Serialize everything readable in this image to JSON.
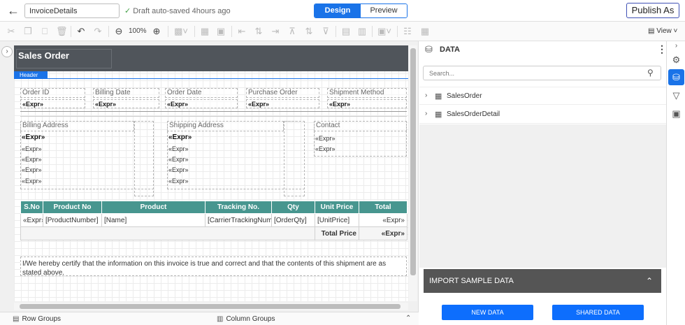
{
  "topbar": {
    "report_name": "InvoiceDetails",
    "autosave": "Draft auto-saved 4hours ago",
    "design_label": "Design",
    "preview_label": "Preview",
    "publish_label": "Publish As"
  },
  "toolbar": {
    "zoom": "100%",
    "view_label": "View"
  },
  "report": {
    "title": "Sales Order",
    "section_tab": "Header",
    "fields_row1": [
      {
        "label": "Order ID",
        "value": "«Expr»"
      },
      {
        "label": "Billing Date",
        "value": "«Expr»"
      },
      {
        "label": "Order Date",
        "value": "«Expr»"
      },
      {
        "label": "Purchase Order",
        "value": "«Expr»"
      },
      {
        "label": "Shipment Method",
        "value": "«Expr»"
      }
    ],
    "billing": {
      "label": "Billing Address",
      "lines": [
        "«Expr»",
        "«Expr»",
        "«Expr»",
        "«Expr»",
        "«Expr»"
      ]
    },
    "shipping": {
      "label": "Shipping Address",
      "lines": [
        "«Expr»",
        "«Expr»",
        "«Expr»",
        "«Expr»",
        "«Expr»"
      ]
    },
    "contact": {
      "label": "Contact",
      "lines": [
        "«Expr»",
        "«Expr»"
      ]
    },
    "table": {
      "headers": [
        "S.No",
        "Product No",
        "Product",
        "Tracking No.",
        "Qty",
        "Unit Price",
        "Total"
      ],
      "row": [
        "«Expr»",
        "[ProductNumber]",
        "[Name]",
        "[CarrierTrackingNumber]",
        "[OrderQty]",
        "[UnitPrice]",
        "«Expr»"
      ],
      "total_label": "Total Price",
      "total_value": "«Expr»"
    },
    "certify": "I/We hereby certify that the information on this invoice is true and correct and that the contents of this shipment are as stated above."
  },
  "bottombar": {
    "row_groups": "Row Groups",
    "column_groups": "Column Groups"
  },
  "data_panel": {
    "title": "DATA",
    "search_placeholder": "Search...",
    "datasets": [
      "SalesOrder",
      "SalesOrderDetail"
    ],
    "import_label": "IMPORT SAMPLE DATA",
    "new_data": "NEW DATA",
    "shared_data": "SHARED DATA"
  }
}
